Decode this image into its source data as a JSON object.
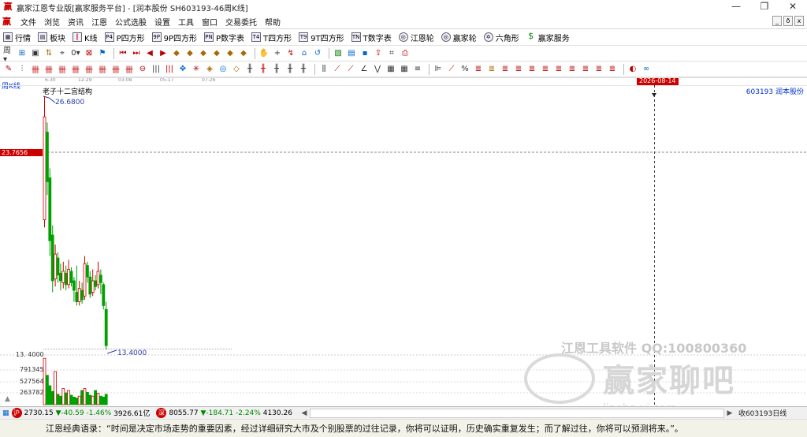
{
  "window": {
    "title": "赢家江恩专业版[赢家服务平台] - [润本股份  SH603193-46周K线]",
    "controls": [
      "—",
      "❐",
      "✕"
    ]
  },
  "menu": {
    "items": [
      "文件",
      "浏览",
      "资讯",
      "江恩",
      "公式选股",
      "设置",
      "工具",
      "窗口",
      "交易委托",
      "帮助"
    ],
    "mdi_controls": [
      "_",
      "ð",
      "x"
    ]
  },
  "toolbar1": {
    "items": [
      {
        "label": "行情",
        "icon": "grid-icon"
      },
      {
        "label": "板块",
        "icon": "blocks-icon"
      },
      {
        "label": "K线",
        "icon": "candles-icon"
      },
      {
        "label": "P四方形",
        "icon": "P4"
      },
      {
        "label": "9P四方形",
        "icon": "9P"
      },
      {
        "label": "P数字表",
        "icon": "PN"
      },
      {
        "label": "T四方形",
        "icon": "T4"
      },
      {
        "label": "9T四方形",
        "icon": "T9"
      },
      {
        "label": "T数字表",
        "icon": "TN"
      },
      {
        "label": "江恩轮",
        "icon": "wheel-icon"
      },
      {
        "label": "赢家轮",
        "icon": "wheel-icon"
      },
      {
        "label": "六角形",
        "icon": "hexagon-icon"
      },
      {
        "label": "赢家服务",
        "icon": "dollar-icon"
      }
    ]
  },
  "chart": {
    "period_label": "周K线",
    "overlay_name": "老子十二宫结构",
    "stock_label": "603193  润本股份",
    "date_flag": "2026-08-14",
    "x_ticks": [
      "6-30",
      "12-29",
      "03-08",
      "05-17",
      "07-26"
    ],
    "current_price_tag": "23.7656",
    "high_annotation": "26.6800",
    "low_annotation": "13.4000",
    "axis_low_label": "13. 4000",
    "volume_labels": [
      "791345",
      "527564",
      "263782"
    ],
    "colors": {
      "up": "#d00000",
      "down": "#00a000",
      "tag": "#c00000",
      "annot": "#2a3fa0"
    }
  },
  "chart_data": {
    "type": "candlestick",
    "title": "老子十二宫结构",
    "high": 26.68,
    "low": 13.4,
    "current": 23.7656,
    "volume_ticks": [
      791345,
      527564,
      263782
    ],
    "x_ticks": [
      "6-30",
      "12-29",
      "03-08",
      "05-17",
      "07-26"
    ],
    "candles": [
      {
        "o": 20.2,
        "c": 25.6,
        "h": 26.68,
        "l": 19.8
      },
      {
        "o": 24.8,
        "c": 22.2,
        "h": 25.3,
        "l": 21.5
      },
      {
        "o": 22.4,
        "c": 19.1,
        "h": 22.9,
        "l": 18.3
      },
      {
        "o": 19.4,
        "c": 17.0,
        "h": 19.9,
        "l": 16.4
      },
      {
        "o": 17.1,
        "c": 18.4,
        "h": 18.9,
        "l": 16.7
      },
      {
        "o": 18.2,
        "c": 17.3,
        "h": 18.5,
        "l": 16.9
      },
      {
        "o": 17.4,
        "c": 17.0,
        "h": 17.9,
        "l": 16.5
      },
      {
        "o": 16.9,
        "c": 17.5,
        "h": 18.0,
        "l": 16.6
      },
      {
        "o": 17.4,
        "c": 16.8,
        "h": 17.8,
        "l": 16.5
      },
      {
        "o": 16.8,
        "c": 17.6,
        "h": 18.1,
        "l": 16.6
      },
      {
        "o": 17.5,
        "c": 16.9,
        "h": 17.7,
        "l": 16.7
      },
      {
        "o": 17.0,
        "c": 16.5,
        "h": 17.2,
        "l": 15.9
      },
      {
        "o": 16.4,
        "c": 15.9,
        "h": 17.8,
        "l": 15.7
      },
      {
        "o": 15.9,
        "c": 16.6,
        "h": 17.0,
        "l": 15.7
      },
      {
        "o": 16.5,
        "c": 16.0,
        "h": 16.9,
        "l": 15.8
      },
      {
        "o": 16.2,
        "c": 17.9,
        "h": 18.3,
        "l": 16.0
      },
      {
        "o": 17.8,
        "c": 17.2,
        "h": 18.0,
        "l": 16.9
      },
      {
        "o": 17.2,
        "c": 16.3,
        "h": 17.5,
        "l": 16.1
      },
      {
        "o": 16.4,
        "c": 17.0,
        "h": 17.6,
        "l": 16.2
      },
      {
        "o": 17.0,
        "c": 16.7,
        "h": 17.3,
        "l": 16.5
      },
      {
        "o": 16.8,
        "c": 17.5,
        "h": 18.0,
        "l": 16.6
      },
      {
        "o": 17.3,
        "c": 16.9,
        "h": 17.6,
        "l": 16.3
      },
      {
        "o": 16.8,
        "c": 15.7,
        "h": 16.9,
        "l": 15.5
      },
      {
        "o": 15.5,
        "c": 13.6,
        "h": 15.9,
        "l": 13.4
      }
    ],
    "volumes": [
      0.98,
      0.62,
      0.4,
      0.28,
      0.7,
      0.22,
      0.18,
      0.34,
      0.25,
      0.3,
      0.2,
      0.16,
      0.14,
      0.18,
      0.3,
      0.34,
      0.26,
      0.2,
      0.18,
      0.3,
      0.24,
      0.18,
      0.16,
      0.22
    ]
  },
  "statusbar": {
    "sh_badge": "沪",
    "sh_index": "2730.15",
    "sh_change": "▼-40.59",
    "sh_pct": "-1.46%",
    "sh_amount": "3926.61亿",
    "sz_badge": "深",
    "sz_index": "8055.77",
    "sz_change": "▼-184.71",
    "sz_pct": "-2.24%",
    "sz_amount": "4130.26",
    "closing": "收603193日线"
  },
  "quote": {
    "text": "江恩经典语录：“时间是决定市场走势的重要因素，经过详细研究大市及个别股票的过往记录，你将可以证明，历史确实重复发生；而了解过往，你将可以预测将来。”。"
  },
  "watermark": {
    "line1": "江恩工具软件  QQ:100800360",
    "line2": "赢家聊吧",
    "line3": "liaoba.yj.com"
  }
}
